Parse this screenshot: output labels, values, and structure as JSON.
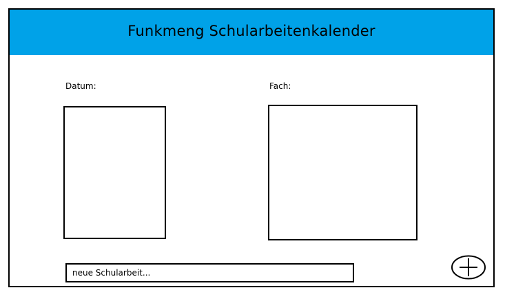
{
  "colors": {
    "header_background": "#00a2e8",
    "border": "#000000",
    "background": "#ffffff"
  },
  "header": {
    "title": "Funkmeng Schularbeitenkalender"
  },
  "form": {
    "datum_label": "Datum:",
    "fach_label": "Fach:",
    "new_entry_placeholder": "neue Schularbeit..."
  },
  "actions": {
    "add_icon": "circle-plus-icon"
  }
}
